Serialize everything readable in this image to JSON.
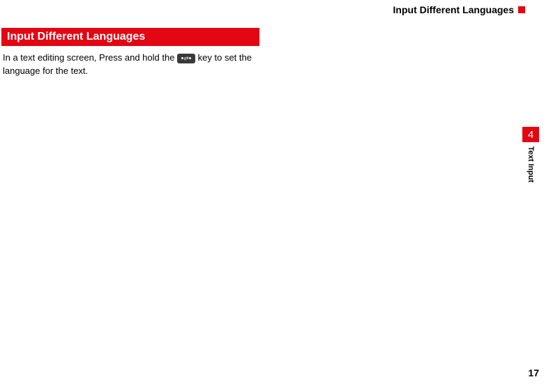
{
  "header": {
    "title": "Input Different Languages"
  },
  "section": {
    "heading": " Input Different Languages",
    "body_pre": "In a text editing screen, Press and hold the ",
    "body_post": " key to set the language for the text."
  },
  "side_tab": {
    "number": "4",
    "label": "Text Input"
  },
  "page_number": "17"
}
